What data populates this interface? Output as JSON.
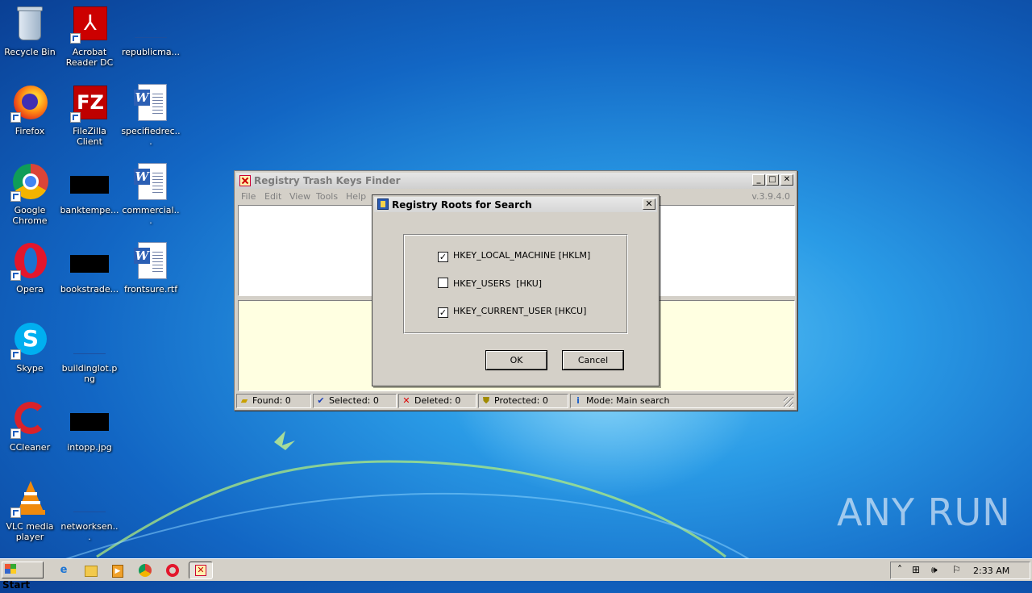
{
  "desktop": {
    "icons": [
      {
        "label": "Recycle Bin",
        "icon": "recycle-bin-icon"
      },
      {
        "label": "Acrobat Reader DC",
        "icon": "acrobat-icon"
      },
      {
        "label": "republicma...",
        "icon": "blank-file-icon"
      },
      {
        "label": "Firefox",
        "icon": "firefox-icon"
      },
      {
        "label": "FileZilla Client",
        "icon": "filezilla-icon"
      },
      {
        "label": "specifiedrec...",
        "icon": "word-doc-icon"
      },
      {
        "label": "Google Chrome",
        "icon": "chrome-icon"
      },
      {
        "label": "banktempe...",
        "icon": "black-thumbnail-icon"
      },
      {
        "label": "commercial...",
        "icon": "word-doc-icon"
      },
      {
        "label": "Opera",
        "icon": "opera-icon"
      },
      {
        "label": "bookstrade...",
        "icon": "black-thumbnail-icon"
      },
      {
        "label": "frontsure.rtf",
        "icon": "word-doc-icon"
      },
      {
        "label": "Skype",
        "icon": "skype-icon"
      },
      {
        "label": "buildinglot.png",
        "icon": "blank-file-icon"
      },
      {
        "label": "CCleaner",
        "icon": "ccleaner-icon"
      },
      {
        "label": "intopp.jpg",
        "icon": "black-thumbnail-icon"
      },
      {
        "label": "VLC media player",
        "icon": "vlc-icon"
      },
      {
        "label": "networksen...",
        "icon": "blank-file-icon"
      }
    ]
  },
  "app_window": {
    "title": "Registry Trash Keys Finder",
    "version": "v.3.9.4.0",
    "menu": [
      "File",
      "Edit",
      "View",
      "Tools",
      "Help"
    ],
    "status": {
      "found": "Found: 0",
      "selected": "Selected: 0",
      "deleted": "Deleted: 0",
      "protected": "Protected: 0",
      "mode": "Mode: Main search"
    }
  },
  "dialog": {
    "title": "Registry Roots for Search",
    "options": [
      {
        "label": "HKEY_LOCAL_MACHINE [HKLM]",
        "checked": true
      },
      {
        "label": "HKEY_USERS  [HKU]",
        "checked": false
      },
      {
        "label": "HKEY_CURRENT_USER [HKCU]",
        "checked": true
      }
    ],
    "ok_label": "OK",
    "cancel_label": "Cancel"
  },
  "taskbar": {
    "start_label": "Start",
    "clock": "2:33 AM"
  },
  "watermark": "ANY RUN",
  "colors": {
    "desktop_blue": "#1a72d0",
    "dialog_face": "#d4d0c8",
    "results_pane_bg": "#ffffe1"
  }
}
